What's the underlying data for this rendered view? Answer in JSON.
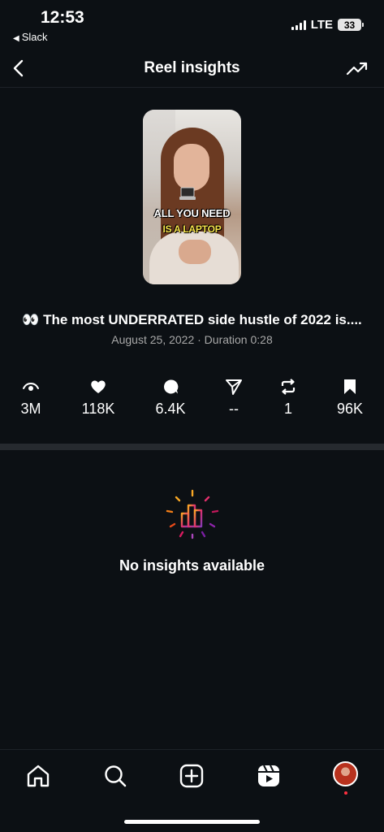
{
  "status_bar": {
    "time": "12:53",
    "back_app": "Slack",
    "network": "LTE",
    "battery": "33"
  },
  "header": {
    "title": "Reel insights",
    "back_icon": "chevron-left-icon",
    "trend_icon": "trending-up-icon"
  },
  "reel": {
    "thumbnail_caption_line1": "ALL YOU NEED",
    "thumbnail_caption_line2": "IS A LAPTOP",
    "title": "👀 The most UNDERRATED side hustle of 2022 is....",
    "meta": "August 25, 2022 · Duration 0:28"
  },
  "stats": [
    {
      "icon": "eye-icon",
      "value": "3M"
    },
    {
      "icon": "heart-icon",
      "value": "118K"
    },
    {
      "icon": "comment-icon",
      "value": "6.4K"
    },
    {
      "icon": "send-icon",
      "value": "--"
    },
    {
      "icon": "repost-icon",
      "value": "1"
    },
    {
      "icon": "bookmark-icon",
      "value": "96K"
    }
  ],
  "empty_state": {
    "icon": "bar-chart-icon",
    "text": "No insights available"
  },
  "bottom_nav": {
    "items": [
      "home-icon",
      "search-icon",
      "create-icon",
      "reels-icon",
      "profile-avatar"
    ]
  },
  "colors": {
    "background": "#0c1014",
    "divider": "#262a2f",
    "meta_text": "#a8a8a8",
    "notification_dot": "#ff3040"
  }
}
